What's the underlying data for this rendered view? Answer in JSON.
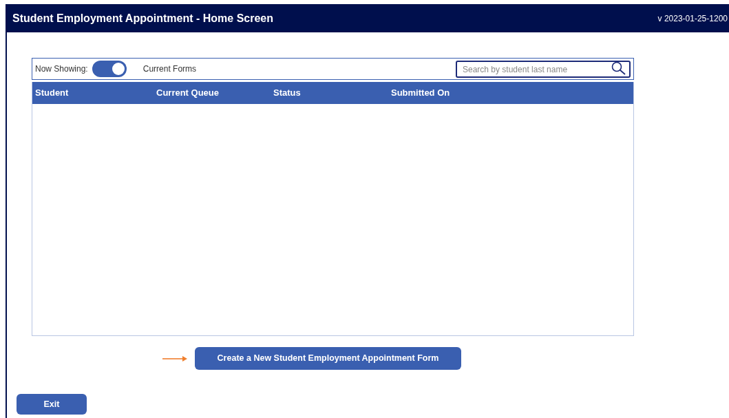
{
  "header": {
    "title": "Student Employment Appointment - Home Screen",
    "version": "v 2023-01-25-1200"
  },
  "filter": {
    "label": "Now Showing:",
    "toggle_on": true,
    "value": "Current Forms"
  },
  "search": {
    "placeholder": "Search by student last name"
  },
  "table": {
    "columns": [
      "Student",
      "Current Queue",
      "Status",
      "Submitted On"
    ]
  },
  "create_button": "Create a New Student Employment Appointment Form",
  "exit_button": "Exit"
}
